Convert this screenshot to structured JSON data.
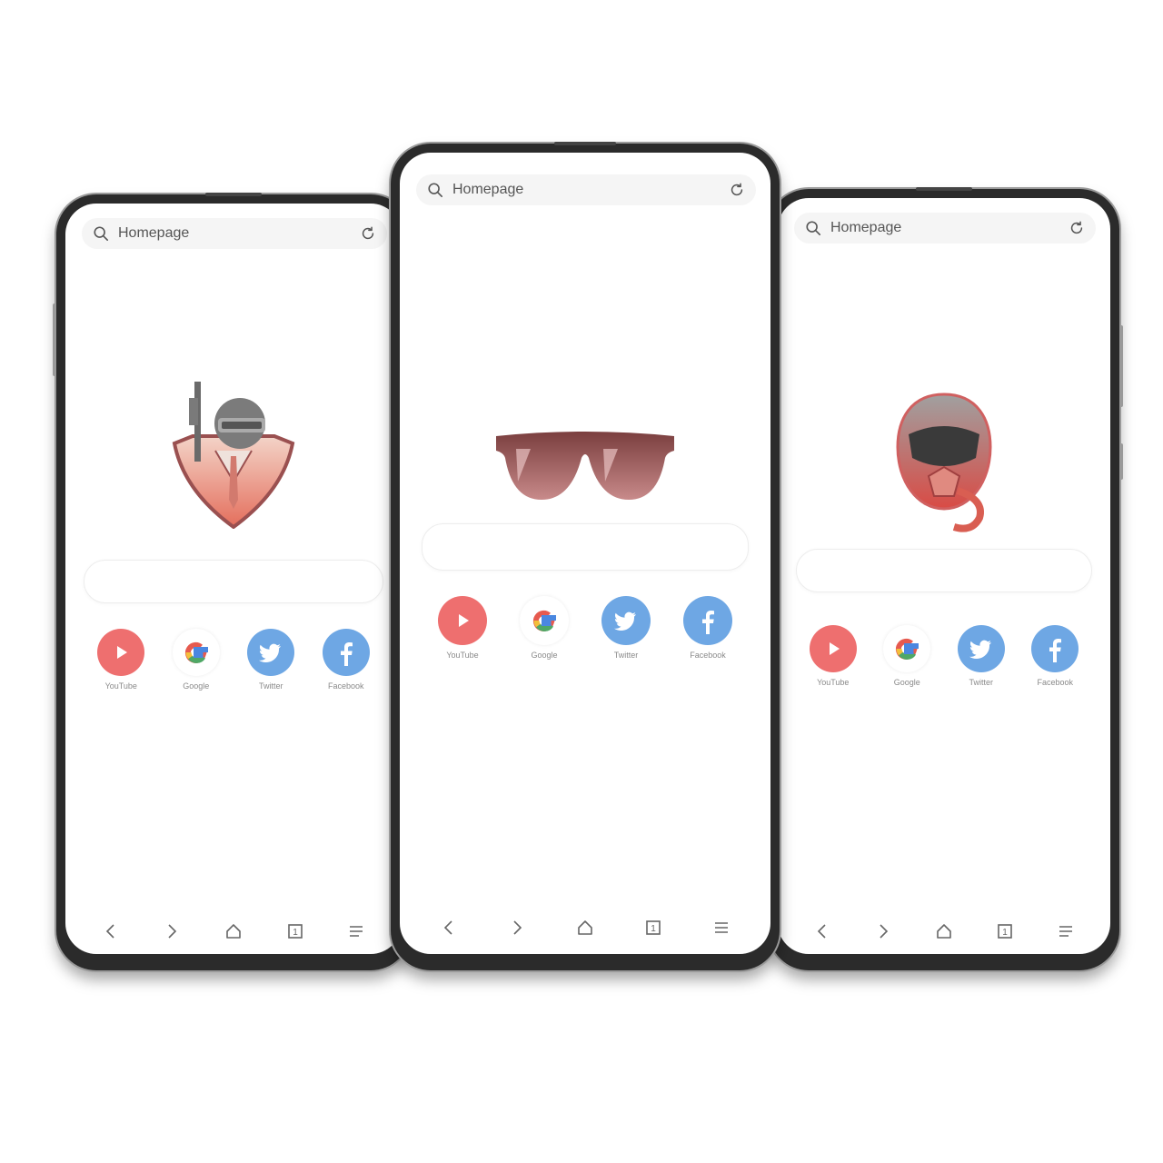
{
  "phones": [
    {
      "id": "left",
      "logo": "soldier-helmet-mascot-icon",
      "url_bar": {
        "placeholder": "Homepage"
      },
      "shortcuts": [
        {
          "label": "YouTube",
          "icon": "youtube-icon"
        },
        {
          "label": "Google",
          "icon": "google-icon"
        },
        {
          "label": "Twitter",
          "icon": "twitter-icon"
        },
        {
          "label": "Facebook",
          "icon": "facebook-icon"
        }
      ],
      "nav": {
        "tab_count": "1"
      }
    },
    {
      "id": "center",
      "logo": "sunglasses-icon",
      "url_bar": {
        "placeholder": "Homepage"
      },
      "shortcuts": [
        {
          "label": "YouTube",
          "icon": "youtube-icon"
        },
        {
          "label": "Google",
          "icon": "google-icon"
        },
        {
          "label": "Twitter",
          "icon": "twitter-icon"
        },
        {
          "label": "Facebook",
          "icon": "facebook-icon"
        }
      ],
      "nav": {
        "tab_count": "1"
      }
    },
    {
      "id": "right",
      "logo": "pilot-helmet-mascot-icon",
      "url_bar": {
        "placeholder": "Homepage"
      },
      "shortcuts": [
        {
          "label": "YouTube",
          "icon": "youtube-icon"
        },
        {
          "label": "Google",
          "icon": "google-icon"
        },
        {
          "label": "Twitter",
          "icon": "twitter-icon"
        },
        {
          "label": "Facebook",
          "icon": "facebook-icon"
        }
      ],
      "nav": {
        "tab_count": "1"
      }
    }
  ],
  "colors": {
    "youtube": "#ee6f6f",
    "twitter": "#6ea7e4",
    "facebook": "#6ea7e4",
    "logo_tint": "#b96a6a"
  }
}
